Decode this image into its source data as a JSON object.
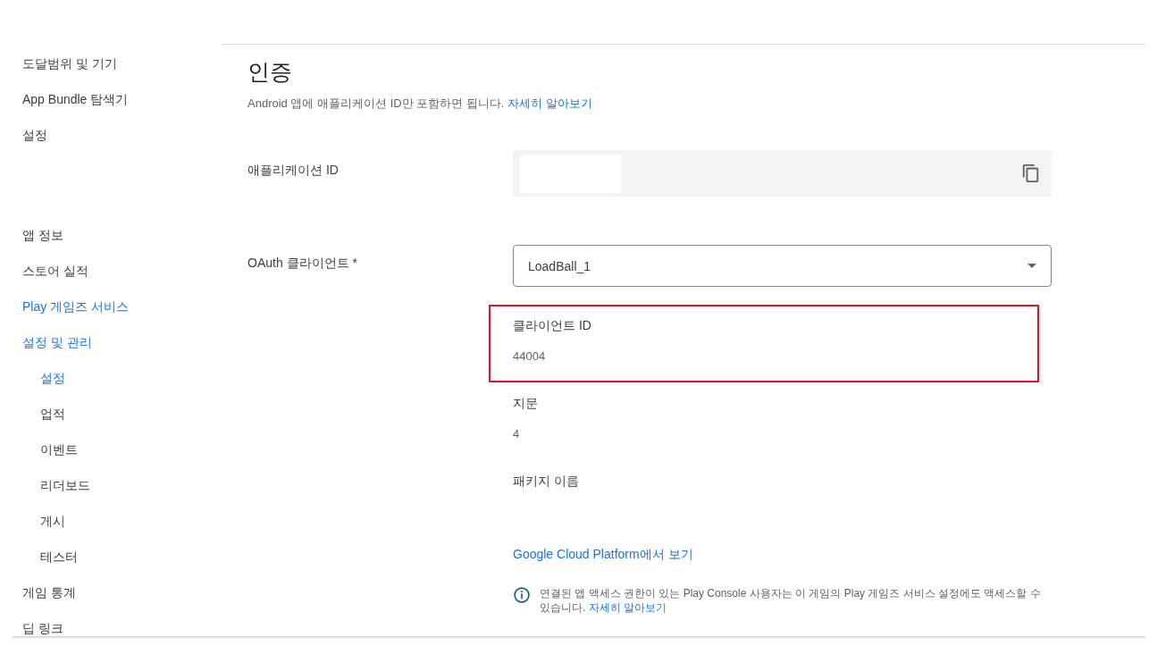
{
  "sidebar": {
    "groups": [
      {
        "items": [
          {
            "label": "도달범위 및 기기",
            "active": false
          },
          {
            "label": "App Bundle 탐색기",
            "active": false
          },
          {
            "label": "설정",
            "active": false
          }
        ]
      },
      {
        "items": [
          {
            "label": "앱 정보",
            "active": false
          },
          {
            "label": "스토어 실적",
            "active": false
          },
          {
            "label": "Play 게임즈 서비스",
            "active": true
          },
          {
            "label": "설정 및 관리",
            "active": true,
            "children": [
              {
                "label": "설정",
                "active": true
              },
              {
                "label": "업적",
                "active": false
              },
              {
                "label": "이벤트",
                "active": false
              },
              {
                "label": "리더보드",
                "active": false
              },
              {
                "label": "게시",
                "active": false
              },
              {
                "label": "테스터",
                "active": false
              }
            ]
          },
          {
            "label": "게임 통계",
            "active": false
          },
          {
            "label": "딥 링크",
            "active": false
          }
        ]
      }
    ]
  },
  "section": {
    "title": "인증",
    "description": "Android 앱에 애플리케이션 ID만 포함하면 됩니다.",
    "description_link": "자세히 알아보기"
  },
  "app_id": {
    "label": "애플리케이션 ID"
  },
  "oauth": {
    "label": "OAuth 클라이언트",
    "required_mark": "*",
    "value": "LoadBall_1"
  },
  "details": [
    {
      "label": "클라이언트 ID",
      "value": "44004",
      "highlighted": true
    },
    {
      "label": "지문",
      "value": "4",
      "highlighted": false
    },
    {
      "label": "패키지 이름",
      "highlighted": false
    }
  ],
  "cloud_link": "Google Cloud Platform에서 보기",
  "notice": {
    "text": "연결된 앱 액세스 권한이 있는 Play Console 사용자는 이 게임의 Play 게임즈 서비스 설정에도 액세스할 수 있습니다.",
    "link": "자세히 알아보기"
  }
}
